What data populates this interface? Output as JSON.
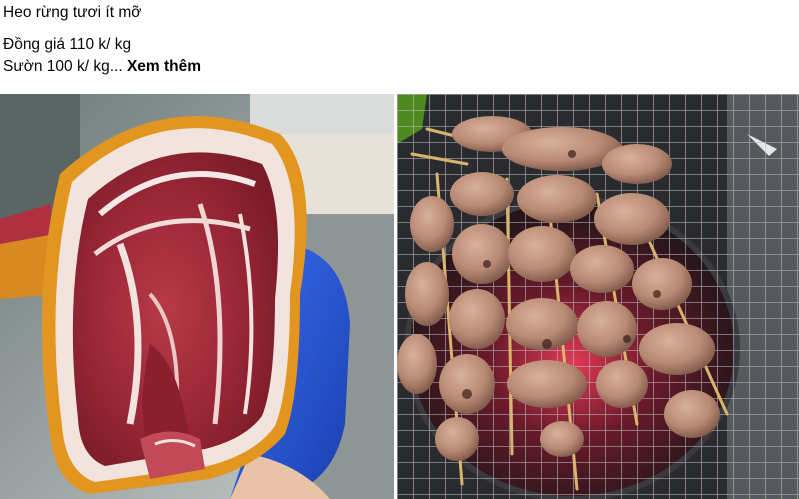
{
  "post": {
    "line1": "Heo rừng tươi ít mỡ",
    "line2": "Đồng giá 110 k/ kg",
    "line3_prefix": "Sườn 100 k/ kg... ",
    "see_more_label": "Xem thêm"
  },
  "photos": [
    {
      "subject": "raw-wild-boar-pork-belly"
    },
    {
      "subject": "grilled-skewers-on-charcoal"
    }
  ],
  "colors": {
    "text": "#050505",
    "meat_red": "#a8323f",
    "fat_white": "#f2e6e2",
    "skin_orange": "#e0931c",
    "glove_blue": "#2456d6",
    "grill_dark": "#1c1c20"
  }
}
